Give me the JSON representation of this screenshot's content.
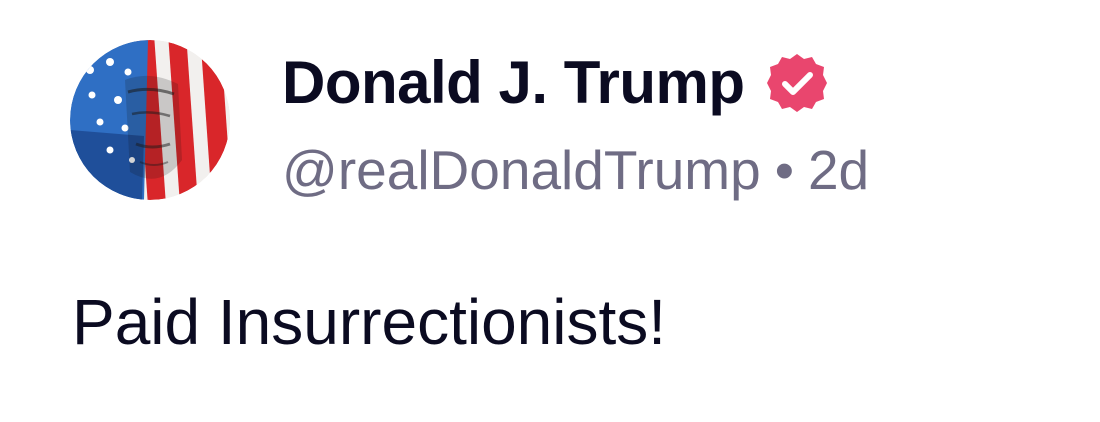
{
  "author": {
    "display_name": "Donald J. Trump",
    "handle": "@realDonaldTrump",
    "verified": true,
    "verified_badge_icon": "verified-badge-icon",
    "verified_badge_color": "#e9466e",
    "avatar_icon": "flag-portrait-avatar"
  },
  "meta": {
    "separator": "•",
    "timestamp": "2d"
  },
  "post": {
    "text": "Paid Insurrectionists!"
  },
  "colors": {
    "text_primary": "#0b0b21",
    "text_secondary": "#6f6c84",
    "background": "#ffffff"
  }
}
